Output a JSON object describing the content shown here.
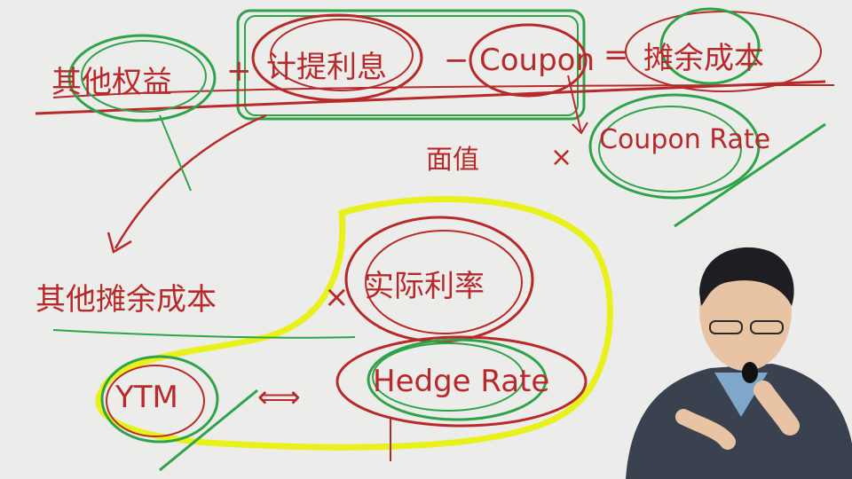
{
  "whiteboard": {
    "row1": {
      "term_a": "其他权益",
      "plus": "+",
      "term_b": "计提利息",
      "minus": "−",
      "term_c": "Coupon",
      "equals": "=",
      "result": "摊余成本"
    },
    "row2": {
      "face": "面值",
      "times": "×",
      "rate": "Coupon Rate"
    },
    "row3": {
      "cost": "其他摊余成本",
      "times": "×",
      "actual": "实际利率"
    },
    "row4": {
      "ytm": "YTM",
      "arrow": "⟺",
      "hedge": "Hedge Rate"
    }
  },
  "colors": {
    "ink_red": "#b82a2a",
    "ink_green": "#2fa34a",
    "ink_yellow": "#e8f21a",
    "board": "#ececea"
  }
}
